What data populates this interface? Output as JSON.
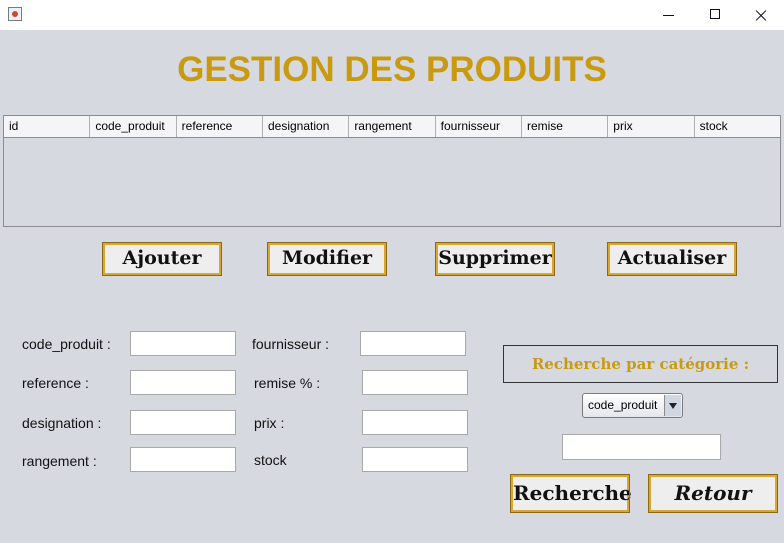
{
  "window": {
    "title": ""
  },
  "page_title": "GESTION DES PRODUITS",
  "table": {
    "columns": [
      "id",
      "code_produit",
      "reference",
      "designation",
      "rangement",
      "fournisseur",
      "remise",
      "prix",
      "stock"
    ],
    "rows": []
  },
  "actions": {
    "add": "Ajouter",
    "edit": "Modifier",
    "delete": "Supprimer",
    "refresh": "Actualiser"
  },
  "form": {
    "code_produit": {
      "label": "code_produit :",
      "value": ""
    },
    "reference": {
      "label": "reference :",
      "value": ""
    },
    "designation": {
      "label": "designation :",
      "value": ""
    },
    "rangement": {
      "label": "rangement :",
      "value": ""
    },
    "fournisseur": {
      "label": "fournisseur :",
      "value": ""
    },
    "remise": {
      "label": "remise % :",
      "value": ""
    },
    "prix": {
      "label": "prix :",
      "value": ""
    },
    "stock": {
      "label": "stock",
      "value": ""
    }
  },
  "search": {
    "title": "Recherche par catégorie :",
    "category_selected": "code_produit",
    "value": "",
    "search_button": "Recherche",
    "back_button": "Retour"
  },
  "colors": {
    "accent": "#c99a10",
    "button_border": "#d8a632"
  }
}
